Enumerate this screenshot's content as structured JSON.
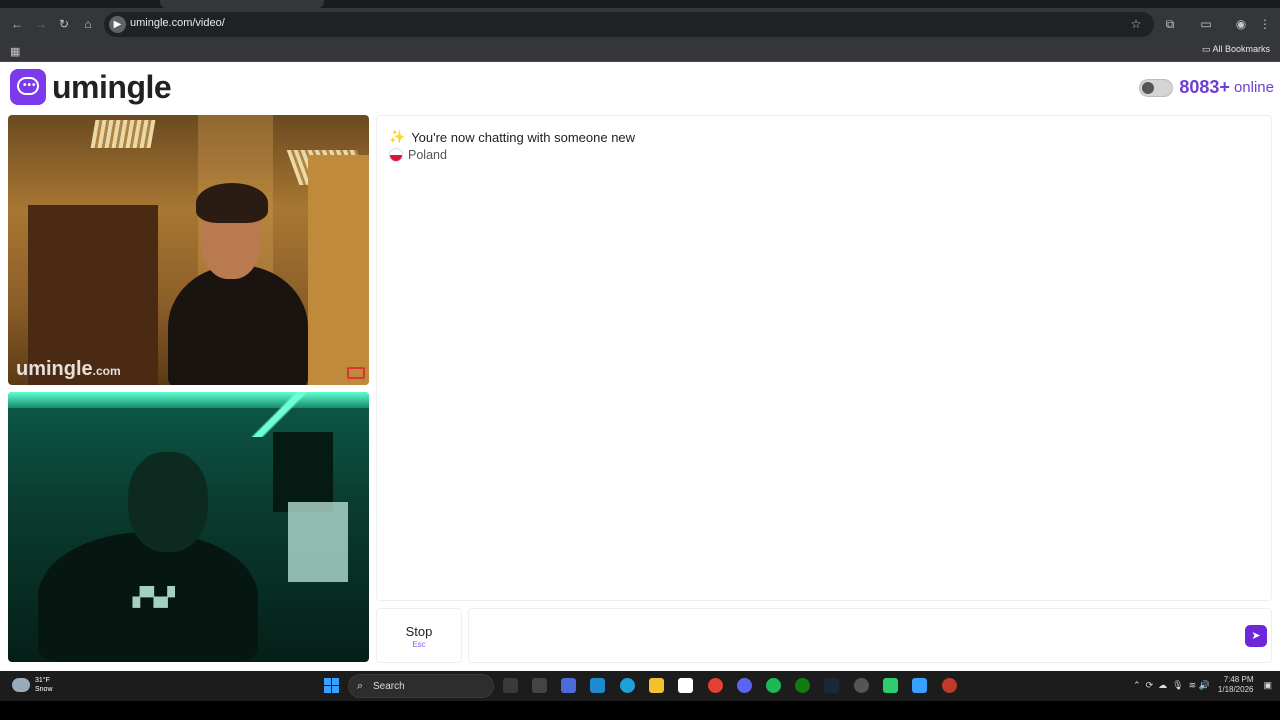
{
  "browser": {
    "url": "umingle.com/video/",
    "bookmarks_label": "All Bookmarks"
  },
  "header": {
    "logo_text": "umingle",
    "online_count": "8083+",
    "online_label": "online"
  },
  "videos": {
    "watermark_main": "umingle",
    "watermark_suffix": ".com"
  },
  "chat": {
    "status_message": "You're now chatting with someone new",
    "country": "Poland"
  },
  "controls": {
    "stop_label": "Stop",
    "stop_hint": "Esc",
    "input_placeholder": ""
  },
  "taskbar": {
    "weather_temp": "31°F",
    "weather_cond": "Snow",
    "search_label": "Search",
    "time": "7:48 PM",
    "date": "1/18/2026"
  },
  "colors": {
    "brand": "#7c3aed",
    "online_text": "#6d3fd0"
  }
}
